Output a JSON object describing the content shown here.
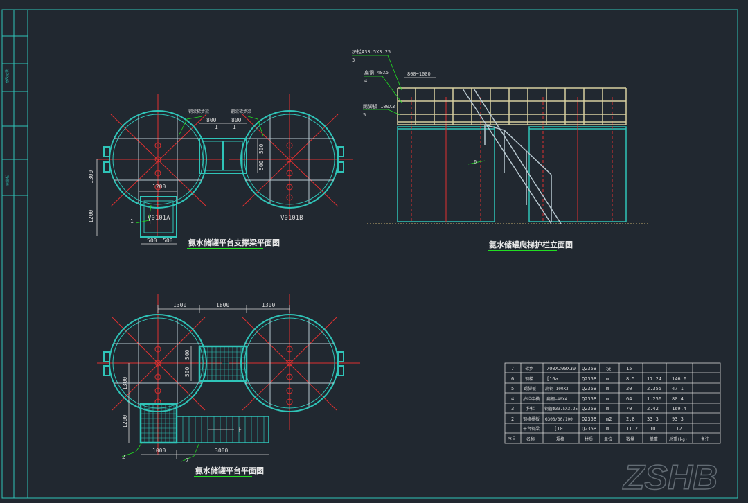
{
  "colors": {
    "background": "#212830",
    "frame": "#2fc4b8",
    "tank": "#2fc4b8",
    "beam": "#b8c8d0",
    "centerline": "#e03030",
    "dimension": "#d8d8d8",
    "title_underline": "#22dd22",
    "railing": "#d8d0a0",
    "leader": "#22dd22"
  },
  "titles": {
    "support_plan": "氨水储罐平台支撑梁平面图",
    "elevation": "氨水储罐爬梯护栏立面图",
    "platform_plan": "氨水储罐平台平面图"
  },
  "support_plan": {
    "tank_a": "V0101A",
    "tank_b": "V0101B",
    "label_left_beam": "钢梁梯步梁",
    "label_right_beam": "钢梁梯步梁",
    "dim_800_left": "800",
    "dim_800_right": "800",
    "dim_1_left": "1",
    "dim_1_right": "1",
    "dim_500_upper": "500",
    "dim_500_lower": "500",
    "dim_1300_vertical": "1300",
    "dim_1200_vertical": "1200",
    "dim_1200_horizontal": "1200",
    "dim_500_bottom_left": "500",
    "dim_500_bottom_right": "500",
    "callout_1_a": "1",
    "callout_1_b": "1"
  },
  "elevation": {
    "callout_3_text": "护栏Φ33.5X3.25",
    "callout_3_num": "3",
    "callout_4_text": "扁钢—40X5",
    "callout_4_num": "4",
    "callout_5_text": "踢脚板—100X3",
    "callout_5_num": "5",
    "dim_800_1000": "800~1000",
    "callout_6": "6"
  },
  "platform_plan": {
    "dim_1300_left": "1300",
    "dim_1800": "1800",
    "dim_1300_right": "1300",
    "dim_500_a": "500",
    "dim_500_b": "500",
    "dim_1300_vertical": "1300",
    "dim_1200_vertical": "1200",
    "dim_1000": "1000",
    "dim_3000": "3000",
    "callout_2": "2",
    "callout_7": "7",
    "stair_up": "上"
  },
  "bom": {
    "rows": [
      [
        "7",
        "梯步",
        "700X200X30",
        "Q235B",
        "块",
        "15",
        "",
        "",
        ""
      ],
      [
        "6",
        "钢梯",
        "[16a",
        "Q235B",
        "m",
        "8.5",
        "17.24",
        "146.6",
        ""
      ],
      [
        "5",
        "踢脚板",
        "扁钢—100X3",
        "Q235B",
        "m",
        "20",
        "2.355",
        "47.1",
        ""
      ],
      [
        "4",
        "护栏中横",
        "扁钢—40X4",
        "Q235B",
        "m",
        "64",
        "1.256",
        "80.4",
        ""
      ],
      [
        "3",
        "护栏",
        "钢管Φ33.5X3.25",
        "Q235B",
        "m",
        "70",
        "2.42",
        "169.4",
        ""
      ],
      [
        "2",
        "钢格栅板",
        "G303/30/100",
        "Q235B",
        "m2",
        "2.8",
        "33.3",
        "93.3",
        ""
      ],
      [
        "1",
        "平台钢梁",
        "[10",
        "Q235B",
        "m",
        "11.2",
        "10",
        "112",
        ""
      ]
    ],
    "header": [
      "序号",
      "名称",
      "规格",
      "材质",
      "单位",
      "数量",
      "单重",
      "总重(kg)",
      "备注"
    ]
  },
  "side_strip": {
    "label_upper": "修改记录",
    "label_lower": "会签栏"
  },
  "watermark": "ZSHB"
}
